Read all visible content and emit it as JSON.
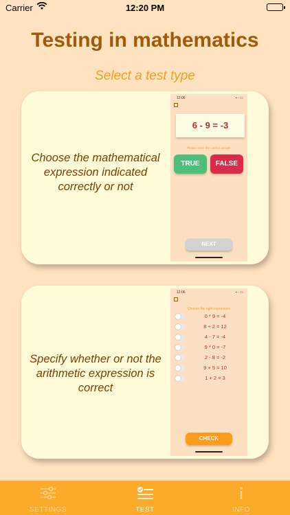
{
  "status_bar": {
    "carrier": "Carrier",
    "time": "12:20 PM"
  },
  "header": {
    "title": "Testing in mathematics",
    "subtitle": "Select a test type"
  },
  "cards": [
    {
      "description": "Choose the mathematical expression indicated correctly or not",
      "preview": {
        "time": "12:06",
        "equation": "6 - 9 = -3",
        "hint": "Please enter the correct answer",
        "true_label": "TRUE",
        "false_label": "FALSE",
        "next_label": "NEXT"
      }
    },
    {
      "description": "Specify whether or not the arithmetic expression is correct",
      "preview": {
        "time": "12:06",
        "title": "Choose the right expression",
        "expressions": [
          "0 * 9 = -4",
          "8 ÷ 2 = 12",
          "4 - 7 = -4",
          "9 * 0 = -7",
          "2 - 8 = -2",
          "9 + 5 = 10",
          "1 + 2 = 3"
        ],
        "check_label": "CHECK"
      }
    }
  ],
  "tabs": [
    {
      "label": "SETTINGS",
      "icon": "sliders-icon"
    },
    {
      "label": "TEST",
      "icon": "checklist-icon",
      "active": true
    },
    {
      "label": "INFO",
      "icon": "info-icon"
    }
  ],
  "colors": {
    "background": "#ffe2c0",
    "title": "#a05a0a",
    "subtitle": "#f0a020",
    "card": "#fefcd8",
    "tabbar": "#fbaa2a",
    "true_button": "#4cc07a",
    "false_button": "#d82c48",
    "check_button": "#ff9a1a"
  }
}
